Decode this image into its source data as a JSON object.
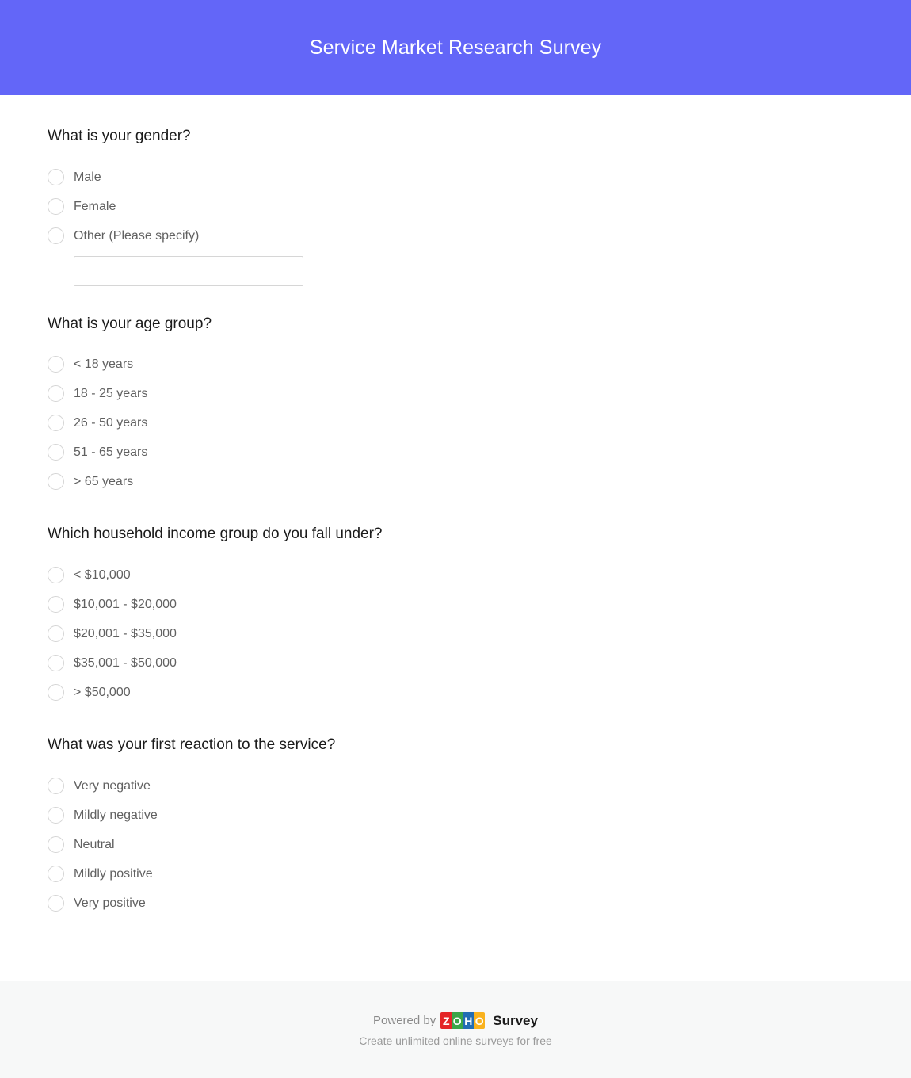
{
  "header": {
    "title": "Service Market Research Survey",
    "background_color": "#6366f8",
    "text_color": "#ffffff"
  },
  "questions": [
    {
      "id": "gender",
      "title": "What is your gender?",
      "options": [
        {
          "label": "Male"
        },
        {
          "label": "Female"
        },
        {
          "label": "Other (Please specify)"
        }
      ],
      "other_input": {
        "value": "",
        "placeholder": ""
      }
    },
    {
      "id": "age-group",
      "title": "What is your age group?",
      "options": [
        {
          "label": "< 18 years"
        },
        {
          "label": "18 - 25 years"
        },
        {
          "label": "26 - 50 years"
        },
        {
          "label": "51 - 65 years"
        },
        {
          "label": "> 65 years"
        }
      ]
    },
    {
      "id": "household-income",
      "title": "Which household income group do you fall under?",
      "options": [
        {
          "label": "< $10,000"
        },
        {
          "label": "$10,001 - $20,000"
        },
        {
          "label": "$20,001 - $35,000"
        },
        {
          "label": "$35,001 - $50,000"
        },
        {
          "label": "> $50,000"
        }
      ]
    },
    {
      "id": "first-reaction",
      "title": "What was your first reaction to the service?",
      "options": [
        {
          "label": "Very negative"
        },
        {
          "label": "Mildly negative"
        },
        {
          "label": "Neutral"
        },
        {
          "label": "Mildly positive"
        },
        {
          "label": "Very positive"
        }
      ]
    }
  ],
  "footer": {
    "powered_by": "Powered by",
    "brand_tiles": [
      {
        "letter": "Z",
        "color": "#e42527"
      },
      {
        "letter": "O",
        "color": "#3aa648"
      },
      {
        "letter": "H",
        "color": "#226db4"
      },
      {
        "letter": "O",
        "color": "#f9b21d"
      }
    ],
    "brand_suffix": "Survey",
    "tagline": "Create unlimited online surveys for free"
  }
}
